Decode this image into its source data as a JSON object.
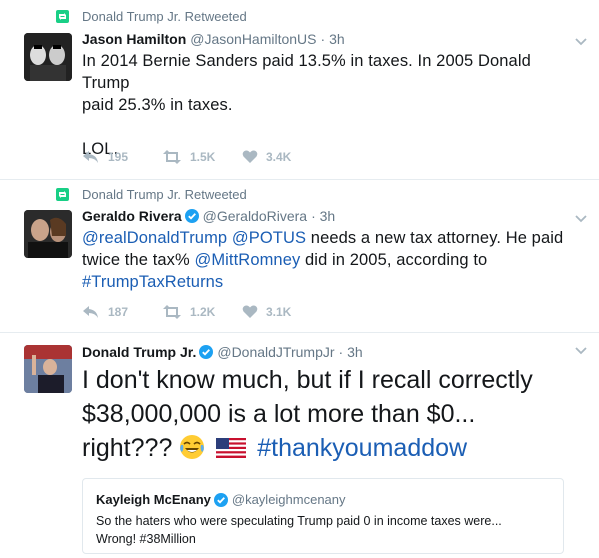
{
  "tweets": [
    {
      "retweeted_by": "Donald Trump Jr. Retweeted",
      "name": "Jason Hamilton",
      "handle": "@JasonHamiltonUS",
      "time": "· 3h",
      "verified": false,
      "text_line1": "In 2014 Bernie Sanders paid 13.5% in taxes. In 2005 Donald Trump",
      "text_line2": "paid 25.3% in taxes.",
      "text_line3": "LOL.",
      "replies": "195",
      "retweets": "1.5K",
      "likes": "3.4K"
    },
    {
      "retweeted_by": "Donald Trump Jr. Retweeted",
      "name": "Geraldo Rivera",
      "handle": "@GeraldoRivera",
      "time": "· 3h",
      "verified": true,
      "mention1": "@realDonaldTrump",
      "mention2": "@POTUS",
      "text_a": " needs a new tax attorney. He paid",
      "text_b": "twice the tax% ",
      "mention3": "@MittRomney",
      "text_c": " did in 2005, according to",
      "hashtag": "#TrumpTaxReturns",
      "replies": "187",
      "retweets": "1.2K",
      "likes": "3.1K"
    },
    {
      "name": "Donald Trump Jr.",
      "handle": "@DonaldJTrumpJr",
      "time": "· 3h",
      "verified": true,
      "text_line1": "I don't know much, but if I recall correctly",
      "text_line2": "$38,000,000 is a lot more than $0...",
      "text_line3": "right???",
      "hashtag": "#thankyoumaddow",
      "emoji1": "face-with-tears-of-joy",
      "emoji2": "us-flag",
      "quote": {
        "name": "Kayleigh McEnany",
        "handle": "@kayleighmcenany",
        "verified": true,
        "text_line1": "So the haters who were speculating Trump paid 0 in income taxes were...",
        "text_line2": "Wrong! #38Million"
      }
    }
  ],
  "colors": {
    "link": "#1b5eb4",
    "retweet_green": "#19cf86",
    "verified_blue": "#1da1f2",
    "muted": "#657786",
    "action_gray": "#aab8c2"
  }
}
